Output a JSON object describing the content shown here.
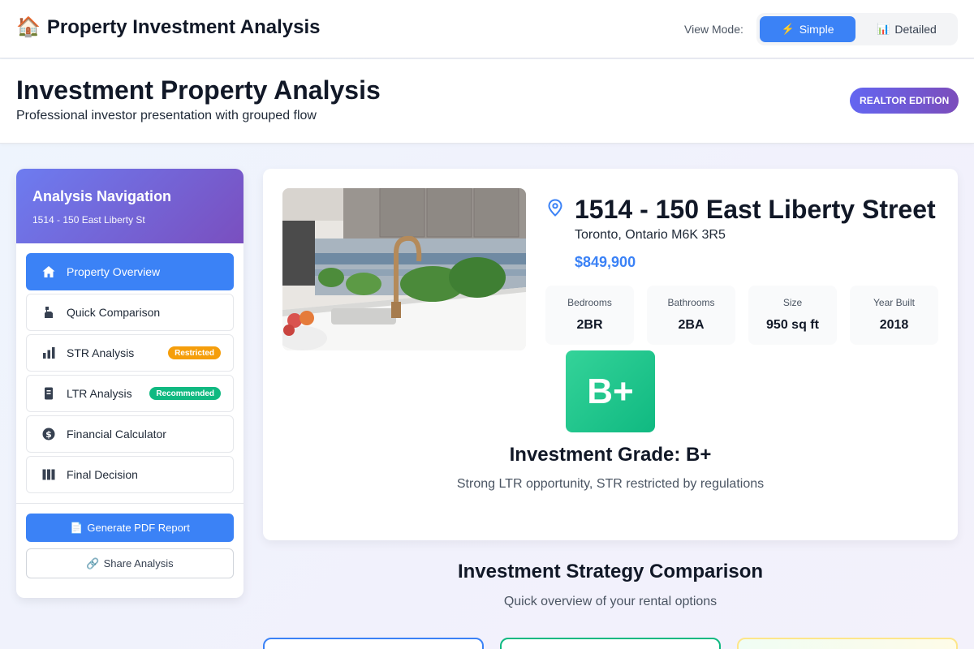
{
  "topbar": {
    "icon": "🏠",
    "title": "Property Investment Analysis",
    "view_mode_label": "View Mode:",
    "toggle": [
      {
        "glyph": "⚡",
        "label": "Simple",
        "active": true
      },
      {
        "glyph": "📊",
        "label": "Detailed",
        "active": false
      }
    ]
  },
  "header": {
    "title": "Investment Property Analysis",
    "subtitle": "Professional investor presentation with grouped flow",
    "badge": "REALTOR EDITION"
  },
  "sidebar": {
    "title": "Analysis Navigation",
    "subtitle": "1514 - 150 East Liberty St",
    "items": [
      {
        "label": "Property Overview",
        "icon": "home-icon",
        "active": true
      },
      {
        "label": "Quick Comparison",
        "icon": "compare-icon"
      },
      {
        "label": "STR Analysis",
        "icon": "bar-chart-icon",
        "badge": "Restricted"
      },
      {
        "label": "LTR Analysis",
        "icon": "document-icon",
        "badge": "Recommended"
      },
      {
        "label": "Financial Calculator",
        "icon": "dollar-icon"
      },
      {
        "label": "Final Decision",
        "icon": "columns-icon"
      }
    ],
    "pdf_button": {
      "glyph": "📄",
      "label": "Generate PDF Report"
    },
    "share_button": {
      "glyph": "🔗",
      "label": "Share Analysis"
    }
  },
  "property": {
    "address": "1514 - 150 East Liberty Street",
    "city": "Toronto, Ontario M6K 3R5",
    "price": "$849,900",
    "stats": [
      {
        "label": "Bedrooms",
        "value": "2BR"
      },
      {
        "label": "Bathrooms",
        "value": "2BA"
      },
      {
        "label": "Size",
        "value": "950 sq ft"
      },
      {
        "label": "Year Built",
        "value": "2018"
      }
    ],
    "grade": "B+",
    "grade_title": "Investment Grade: B+",
    "grade_desc": "Strong LTR opportunity, STR restricted by regulations"
  },
  "strategy": {
    "title": "Investment Strategy Comparison",
    "subtitle": "Quick overview of your rental options"
  },
  "colors": {
    "accent": "#3b82f6",
    "success": "#10b981",
    "warning": "#f59e0b",
    "purple": "#7a4fbf"
  }
}
